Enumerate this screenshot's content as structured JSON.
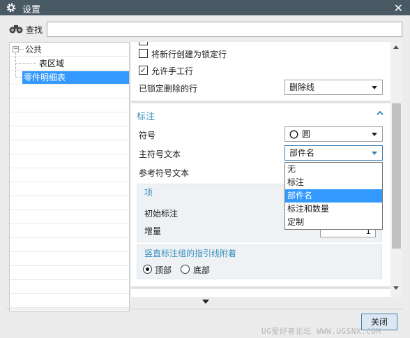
{
  "window": {
    "title": "设置",
    "close_glyph": "✕"
  },
  "search": {
    "label": "查找",
    "value": "",
    "placeholder": ""
  },
  "tree": {
    "root": {
      "label": "公共",
      "expander": "−"
    },
    "child": {
      "label": "表区域"
    },
    "selected": {
      "label": "零件明细表"
    }
  },
  "section_top": {
    "new_row_lock_label": "将新行创建为锁定行",
    "new_row_lock_checked": false,
    "allow_manual_row_label": "允许手工行",
    "allow_manual_row_checked": true,
    "locked_deleted_rows_label": "已锁定删除的行",
    "locked_deleted_rows_value": "删除线"
  },
  "section_label": {
    "title": "标注",
    "symbol_label": "符号",
    "symbol_icon": "circle-icon",
    "symbol_value": "圆",
    "main_symbol_text_label": "主符号文本",
    "main_symbol_text_value": "部件名",
    "ref_symbol_text_label": "参考符号文本",
    "item_box": {
      "title": "项",
      "initial_label": "初始标注",
      "increment_label": "增量",
      "increment_value": "1"
    },
    "leader_box": {
      "title": "竖直标注组的指引线附着",
      "top_label": "顶部",
      "bottom_label": "底部",
      "selected": "顶部"
    }
  },
  "dropdown_options": [
    {
      "label": "无",
      "highlighted": false
    },
    {
      "label": "标注",
      "highlighted": false
    },
    {
      "label": "部件名",
      "highlighted": true
    },
    {
      "label": "标注和数量",
      "highlighted": false
    },
    {
      "label": "定制",
      "highlighted": false
    }
  ],
  "footer": {
    "close_label": "关闭"
  },
  "watermark": "UG爱好者论坛 WWW.UGSNX.COM",
  "colors": {
    "accent": "#3399ff",
    "section_title": "#3a8fbf",
    "titlebar": "#4a5a65"
  }
}
